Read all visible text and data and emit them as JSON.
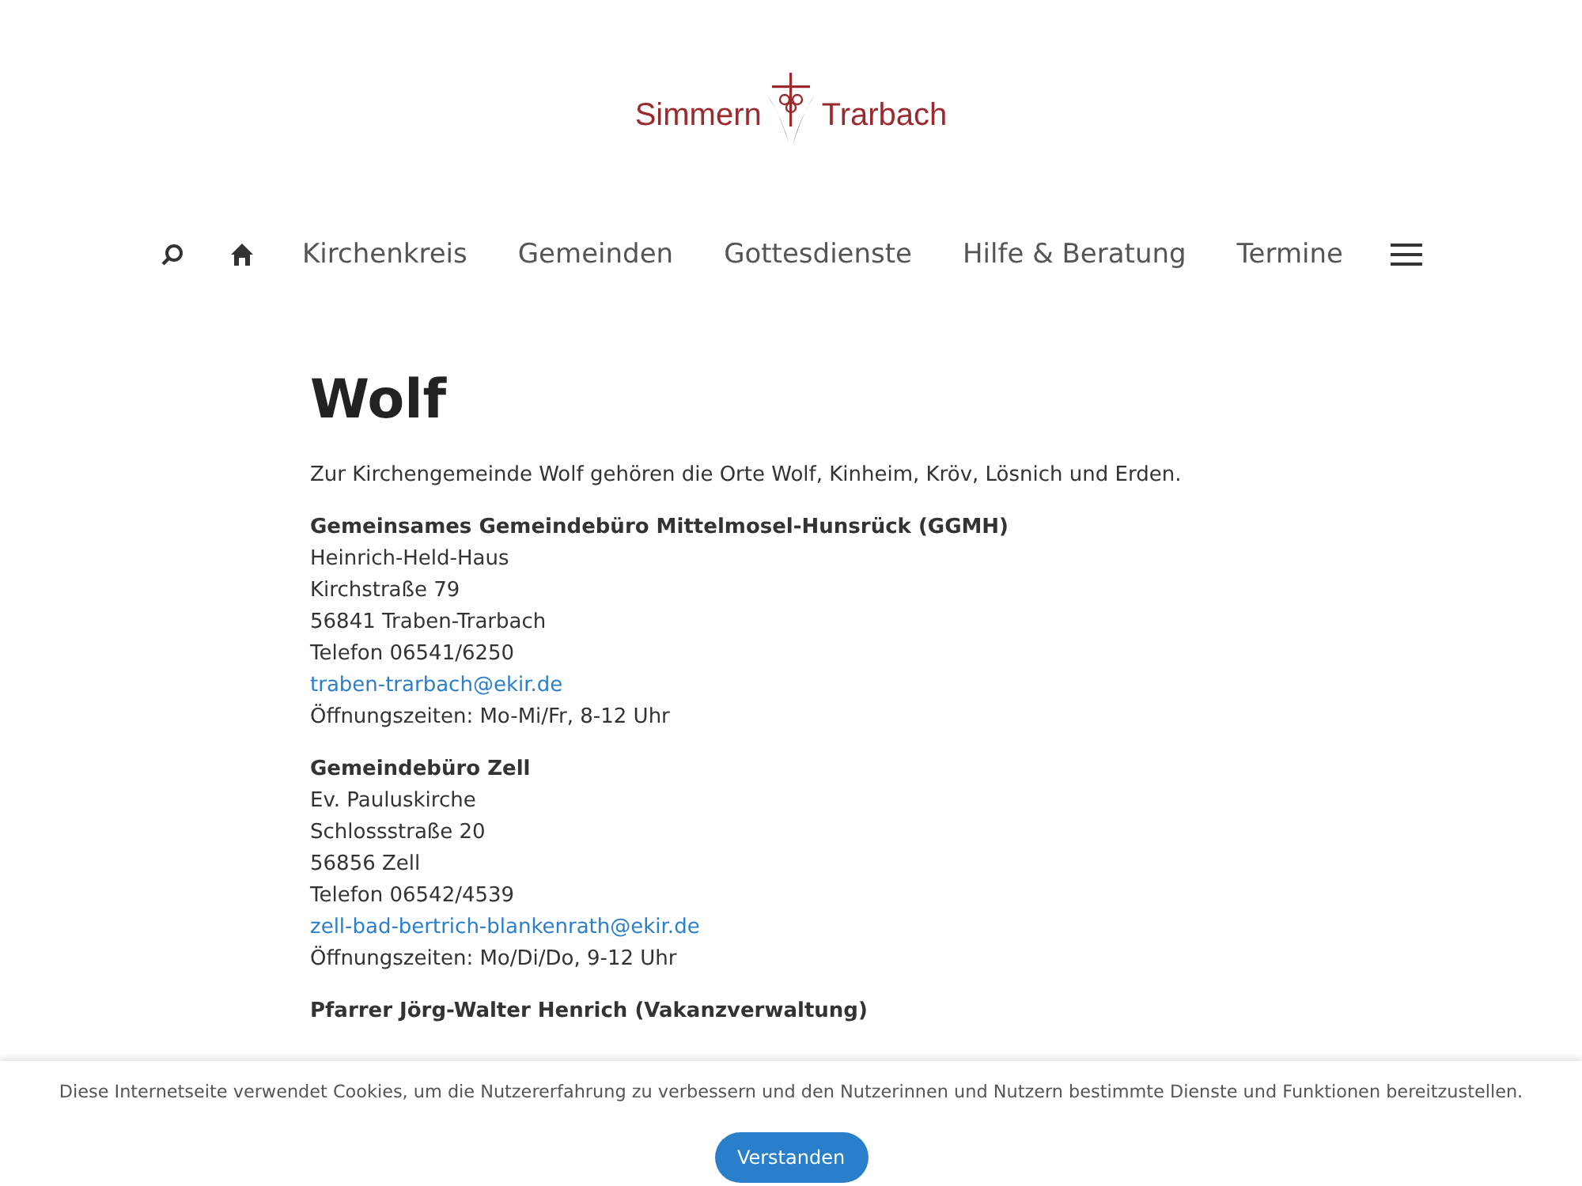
{
  "logo": {
    "left": "Simmern",
    "right": "Trarbach"
  },
  "nav": {
    "items": [
      {
        "label": "Kirchenkreis"
      },
      {
        "label": "Gemeinden"
      },
      {
        "label": "Gottesdienste"
      },
      {
        "label": "Hilfe & Beratung"
      },
      {
        "label": "Termine"
      }
    ]
  },
  "page": {
    "title": "Wolf",
    "intro": "Zur Kirchengemeinde Wolf gehören die Orte Wolf, Kinheim, Kröv, Lösnich und Erden.",
    "blocks": [
      {
        "title": "Gemeinsames Gemeindebüro Mittelmosel-Hunsrück (GGMH)",
        "lines": [
          {
            "kind": "text",
            "text": "Heinrich-Held-Haus"
          },
          {
            "kind": "text",
            "text": "Kirchstraße 79"
          },
          {
            "kind": "text",
            "text": "56841 Traben-Trarbach"
          },
          {
            "kind": "text",
            "text": "Telefon 06541/6250"
          },
          {
            "kind": "link",
            "text": "traben-trarbach@ekir.de"
          },
          {
            "kind": "text",
            "text": "Öffnungszeiten: Mo-Mi/Fr, 8-12 Uhr"
          }
        ]
      },
      {
        "title": "Gemeindebüro Zell",
        "lines": [
          {
            "kind": "text",
            "text": "Ev. Pauluskirche"
          },
          {
            "kind": "text",
            "text": "Schlossstraße 20"
          },
          {
            "kind": "text",
            "text": "56856 Zell"
          },
          {
            "kind": "text",
            "text": "Telefon 06542/4539"
          },
          {
            "kind": "link",
            "text": "zell-bad-bertrich-blankenrath@ekir.de"
          },
          {
            "kind": "text",
            "text": "Öffnungszeiten: Mo/Di/Do, 9-12 Uhr"
          }
        ]
      },
      {
        "title": "Pfarrer Jörg-Walter Henrich (Vakanzverwaltung)"
      }
    ]
  },
  "cookie_bar": {
    "text": "Diese Internetseite verwendet Cookies, um die Nutzererfahrung zu verbessern und den Nutzerinnen und Nutzern bestimmte Dienste und Funktionen bereitzustellen.",
    "button": "Verstanden"
  }
}
